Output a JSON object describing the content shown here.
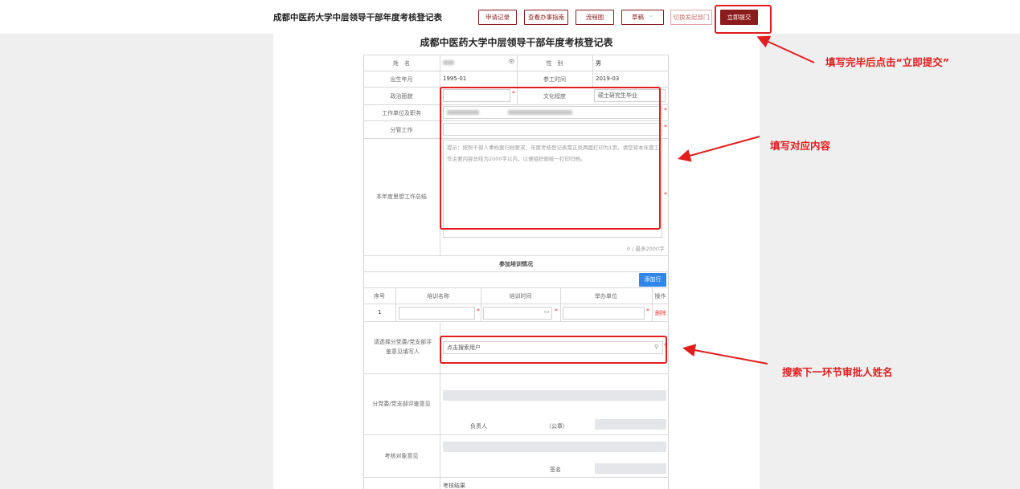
{
  "header": {
    "title": "成都中医药大学中层领导干部年度考核登记表",
    "buttons": {
      "records": "申请记录",
      "guide": "查看办事指南",
      "flow": "流程图",
      "draft": "草稿",
      "switch_dept": "切换发起部门",
      "submit": "立即提交"
    }
  },
  "form": {
    "title": "成都中医药大学中层领导干部年度考核登记表",
    "labels": {
      "name": "姓　名",
      "gender": "性　别",
      "birth": "出生年月",
      "work_start": "参工时间",
      "political": "政治面貌",
      "education": "文化程度",
      "unit_position": "工作单位及职务",
      "duty": "分管工作",
      "summary": "本年度思想工作总结",
      "reviewer": "请选择分党委/党支部评鉴意见填写人",
      "branch_opinion": "分党委/党支部评鉴意见",
      "leader": "负责人",
      "seal": "（公章）",
      "subject_opinion": "考核对象意见",
      "sign": "签名",
      "result": "考核结果"
    },
    "values": {
      "gender": "男",
      "birth": "1995-01",
      "work_start": "2019-03",
      "education": "硕士研究生毕业"
    },
    "summary_hint": "提示：按照干部人事档案归档要求，年度考核登记表需正反两面打印为1页，请您将本年度工作主要内容总结为2000字以内，以便组织部统一打印归档。",
    "summary_counter": "0 / 最多2000字",
    "reviewer_placeholder": "点击搜索用户",
    "required_mark": "*"
  },
  "training": {
    "section_title": "参加培训情况",
    "add_button": "添加行",
    "columns": [
      "序号",
      "培训名称",
      "培训时间",
      "举办单位",
      "操作"
    ],
    "rows": [
      {
        "index": "1",
        "action": "删除"
      }
    ]
  },
  "annotations": {
    "submit_note": "填写完毕后点击“立即提交”",
    "fill_note": "填写对应内容",
    "search_note": "搜索下一环节审批人姓名"
  },
  "colors": {
    "brand": "#8c1b1b",
    "annotation": "#e21d1d",
    "add_button": "#2f87ea",
    "required": "#e23b3b"
  },
  "icons": [
    "eye-icon",
    "calendar-icon",
    "search-icon",
    "chevron-down-icon"
  ]
}
